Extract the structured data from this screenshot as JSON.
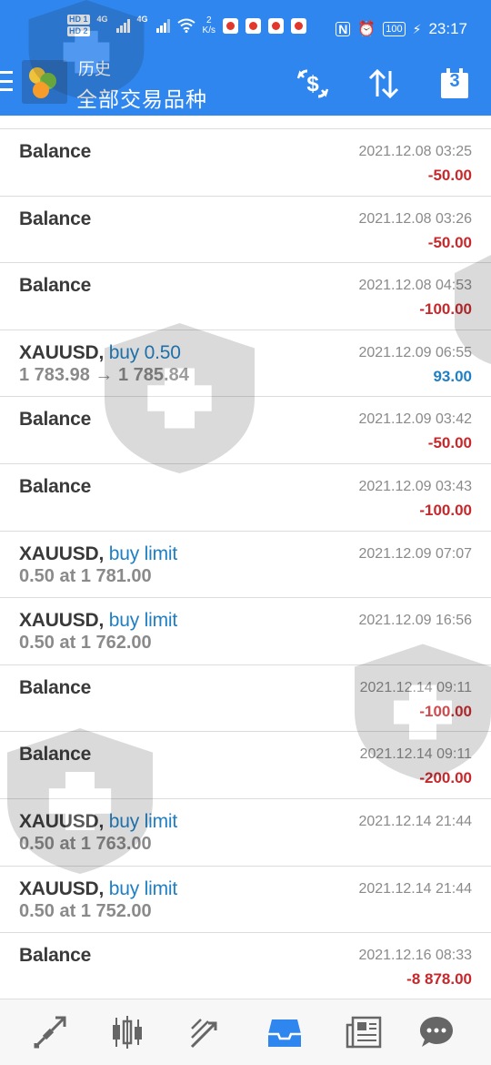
{
  "status_bar": {
    "sim1": "HD 1",
    "sim2": "HD 2",
    "net1": "4G",
    "net2": "4G",
    "speed_value": "2",
    "speed_unit": "K/s",
    "battery": "100",
    "time": "23:17"
  },
  "header": {
    "title": "历史",
    "subtitle": "全部交易品种",
    "calendar_day": "3",
    "icons": [
      "menu-icon",
      "app-logo",
      "currency-exchange-icon",
      "sort-icon",
      "calendar-icon"
    ]
  },
  "colors": {
    "header_bg": "#2f86ee",
    "negative": "#c6282c",
    "positive": "#1f7fc4",
    "nav_active": "#2f86ee"
  },
  "rows": [
    {
      "title": "Balance",
      "sep": "",
      "type": "",
      "detail": "",
      "time": "2021.12.08 03:25",
      "amount": "-50.00",
      "sign": "neg"
    },
    {
      "title": "Balance",
      "sep": "",
      "type": "",
      "detail": "",
      "time": "2021.12.08 03:26",
      "amount": "-50.00",
      "sign": "neg"
    },
    {
      "title": "Balance",
      "sep": "",
      "type": "",
      "detail": "",
      "time": "2021.12.08 04:53",
      "amount": "-100.00",
      "sign": "neg"
    },
    {
      "title": "XAUUSD",
      "sep": ", ",
      "type": "buy 0.50",
      "detail": "1 783.98 → 1 785.84",
      "time": "2021.12.09 06:55",
      "amount": "93.00",
      "sign": "pos"
    },
    {
      "title": "Balance",
      "sep": "",
      "type": "",
      "detail": "",
      "time": "2021.12.09 03:42",
      "amount": "-50.00",
      "sign": "neg"
    },
    {
      "title": "Balance",
      "sep": "",
      "type": "",
      "detail": "",
      "time": "2021.12.09 03:43",
      "amount": "-100.00",
      "sign": "neg"
    },
    {
      "title": "XAUUSD",
      "sep": ", ",
      "type": "buy limit",
      "detail": "0.50 at 1 781.00",
      "time": "2021.12.09 07:07",
      "amount": "",
      "sign": ""
    },
    {
      "title": "XAUUSD",
      "sep": ", ",
      "type": "buy limit",
      "detail": "0.50 at 1 762.00",
      "time": "2021.12.09 16:56",
      "amount": "",
      "sign": ""
    },
    {
      "title": "Balance",
      "sep": "",
      "type": "",
      "detail": "",
      "time": "2021.12.14 09:11",
      "amount": "-100.00",
      "sign": "neg"
    },
    {
      "title": "Balance",
      "sep": "",
      "type": "",
      "detail": "",
      "time": "2021.12.14 09:11",
      "amount": "-200.00",
      "sign": "neg"
    },
    {
      "title": "XAUUSD",
      "sep": ", ",
      "type": "buy limit",
      "detail": "0.50 at 1 763.00",
      "time": "2021.12.14 21:44",
      "amount": "",
      "sign": ""
    },
    {
      "title": "XAUUSD",
      "sep": ", ",
      "type": "buy limit",
      "detail": "0.50 at 1 752.00",
      "time": "2021.12.14 21:44",
      "amount": "",
      "sign": ""
    },
    {
      "title": "Balance",
      "sep": "",
      "type": "",
      "detail": "",
      "time": "2021.12.16 08:33",
      "amount": "-8 878.00",
      "sign": "neg"
    }
  ],
  "bottom_nav": {
    "active": "history",
    "items": [
      "quotes-icon",
      "chart-icon",
      "trade-icon",
      "history-icon",
      "news-icon",
      "chat-icon"
    ]
  }
}
